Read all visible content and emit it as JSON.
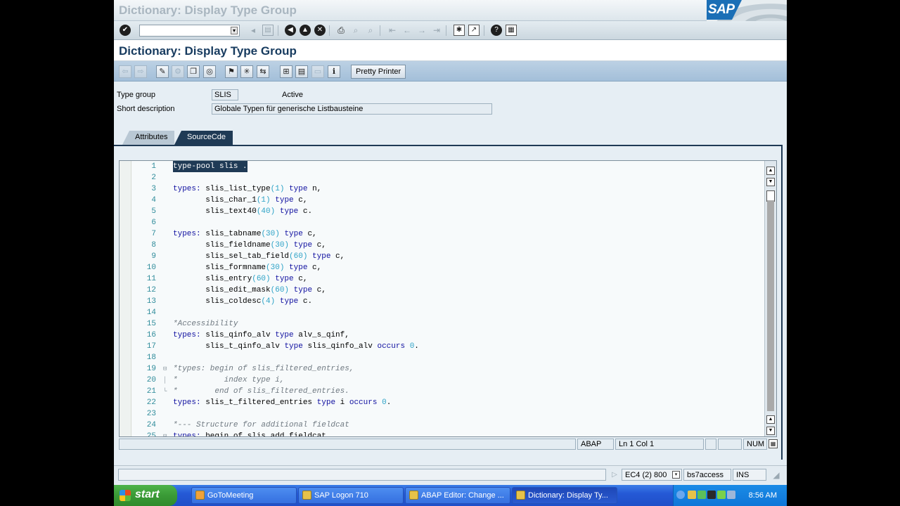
{
  "window": {
    "title": "Dictionary: Display Type Group"
  },
  "command_field": {
    "value": ""
  },
  "screen": {
    "title": "Dictionary: Display Type Group"
  },
  "app_toolbar": {
    "pretty_printer": "Pretty Printer"
  },
  "fields": {
    "type_group_label": "Type group",
    "type_group_value": "SLIS",
    "status": "Active",
    "short_desc_label": "Short description",
    "short_desc_value": "Globale Typen für generische Listbausteine"
  },
  "tabs": [
    {
      "label": "Attributes",
      "active": false
    },
    {
      "label": "SourceCde",
      "active": true
    }
  ],
  "editor": {
    "status": {
      "language": "ABAP",
      "position": "Ln  1 Col  1",
      "mode": "NUM"
    }
  },
  "statusbar": {
    "system": "EC4 (2) 800",
    "server": "bs7access",
    "mode": "INS"
  },
  "taskbar": {
    "start": "start",
    "tasks": [
      "GoToMeeting",
      "SAP Logon 710",
      "ABAP Editor: Change ...",
      "Dictionary: Display Ty..."
    ],
    "clock": "8:56 AM"
  },
  "icons": {
    "sap_logo": "SAP"
  }
}
